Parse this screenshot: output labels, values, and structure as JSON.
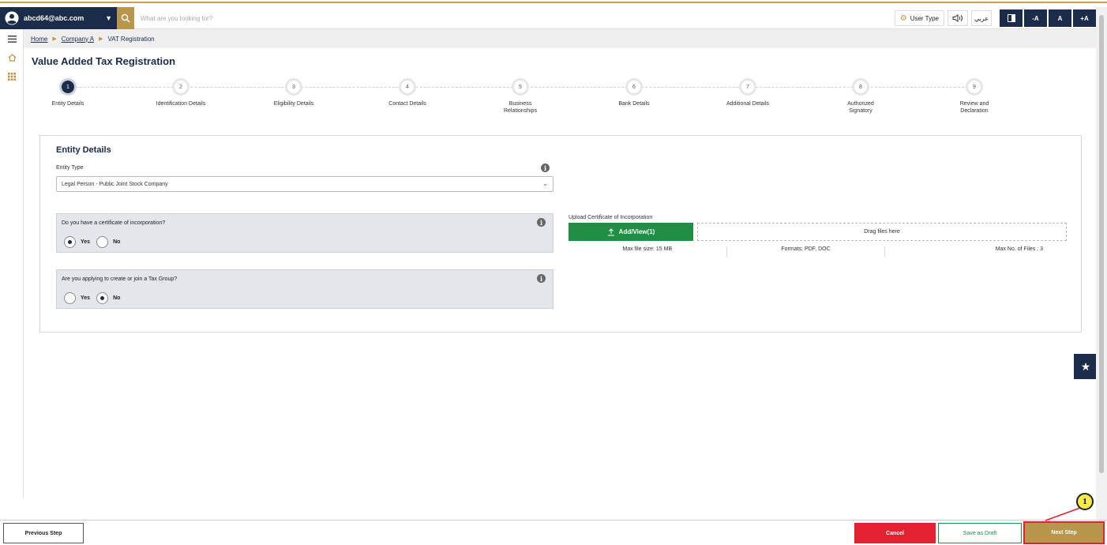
{
  "header": {
    "user_email": "abcd64@abc.com",
    "search_placeholder": "What are you looking for?",
    "user_type_label": "User Type",
    "language_label": "عربي",
    "font_decrease": "-A",
    "font_normal": "A",
    "font_increase": "+A"
  },
  "breadcrumb": {
    "home": "Home",
    "company": "Company A",
    "current": "VAT Registration"
  },
  "page_title": "Value Added Tax Registration",
  "steps": [
    {
      "number": "1",
      "label": "Entity Details",
      "active": true
    },
    {
      "number": "2",
      "label": "Identification Details"
    },
    {
      "number": "3",
      "label": "Eligibility Details"
    },
    {
      "number": "4",
      "label": "Contact Details"
    },
    {
      "number": "5",
      "label": "Business Relationships"
    },
    {
      "number": "6",
      "label": "Bank Details"
    },
    {
      "number": "7",
      "label": "Additional Details"
    },
    {
      "number": "8",
      "label": "Authorized Signatory"
    },
    {
      "number": "9",
      "label": "Review and Declaration"
    }
  ],
  "form": {
    "section_title": "Entity Details",
    "entity_type_label": "Entity Type",
    "entity_type_value": "Legal Person - Public Joint Stock Company",
    "q1_text": "Do you have a certificate of incorporation?",
    "q1_selected": "Yes",
    "q2_text": "Are you applying to create or join a Tax Group?",
    "q2_selected": "No",
    "yes_label": "Yes",
    "no_label": "No"
  },
  "upload": {
    "label": "Upload Certificate of Incorporation",
    "button_label": "Add/View(1)",
    "drag_text": "Drag files here",
    "max_size": "Max file size: 15 MB",
    "formats": "Formats: PDF, DOC",
    "max_files": "Max No. of Files : 3"
  },
  "footer": {
    "previous": "Previous Step",
    "cancel": "Cancel",
    "save_draft": "Save as Draft",
    "next": "Next Step"
  },
  "callout_number": "1",
  "icons": [
    "user-icon",
    "chevron-down-icon",
    "search-icon",
    "gear-icon",
    "speaker-icon",
    "contrast-icon",
    "menu-icon",
    "home-icon",
    "grid-icon",
    "info-icon",
    "upload-icon",
    "star-icon"
  ],
  "colors": {
    "navy": "#1b2b4a",
    "gold": "#b8964c",
    "green": "#1e8f45",
    "red": "#e42131"
  }
}
